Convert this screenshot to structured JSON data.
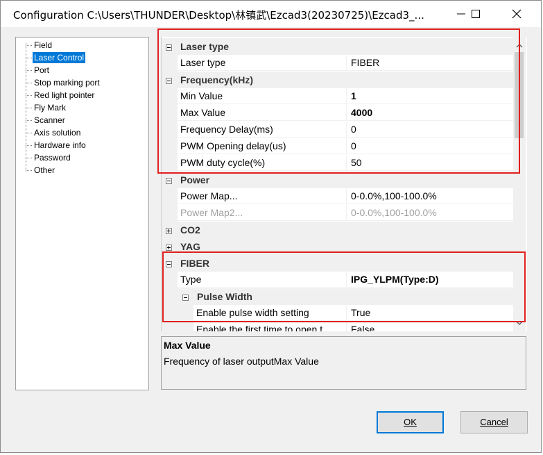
{
  "window": {
    "title": "Configuration C:\\Users\\THUNDER\\Desktop\\林镇武\\Ezcad3(20230725)\\Ezcad3_...",
    "buttons": [
      "minimize",
      "maximize",
      "close"
    ]
  },
  "tree": {
    "items": [
      {
        "label": "Field",
        "selected": false
      },
      {
        "label": "Laser Control",
        "selected": true
      },
      {
        "label": "Port",
        "selected": false
      },
      {
        "label": "Stop marking port",
        "selected": false
      },
      {
        "label": "Red light pointer",
        "selected": false
      },
      {
        "label": "Fly Mark",
        "selected": false
      },
      {
        "label": "Scanner",
        "selected": false
      },
      {
        "label": "Axis solution",
        "selected": false
      },
      {
        "label": "Hardware info",
        "selected": false
      },
      {
        "label": "Password",
        "selected": false
      },
      {
        "label": "Other",
        "selected": false
      }
    ]
  },
  "grid": {
    "rows": [
      {
        "kind": "category",
        "label": "Laser type",
        "expanded": true
      },
      {
        "kind": "prop",
        "name": "Laser type",
        "value": "FIBER"
      },
      {
        "kind": "category",
        "label": "Frequency(kHz)",
        "expanded": true
      },
      {
        "kind": "prop",
        "name": "Min Value",
        "value": "1",
        "bold": true
      },
      {
        "kind": "prop",
        "name": "Max Value",
        "value": "4000",
        "bold": true
      },
      {
        "kind": "prop",
        "name": "Frequency Delay(ms)",
        "value": "0"
      },
      {
        "kind": "prop",
        "name": "PWM Opening delay(us)",
        "value": "0"
      },
      {
        "kind": "prop",
        "name": "PWM duty cycle(%)",
        "value": "50"
      },
      {
        "kind": "category",
        "label": "Power",
        "expanded": true
      },
      {
        "kind": "prop",
        "name": "Power Map...",
        "value": "0-0.0%,100-100.0%"
      },
      {
        "kind": "prop",
        "name": "Power Map2...",
        "value": "0-0.0%,100-100.0%",
        "disabled": true
      },
      {
        "kind": "category",
        "label": "CO2",
        "expanded": false
      },
      {
        "kind": "category",
        "label": "YAG",
        "expanded": false
      },
      {
        "kind": "category",
        "label": "FIBER",
        "expanded": true
      },
      {
        "kind": "prop",
        "name": "Type",
        "value": "IPG_YLPM(Type:D)",
        "bold": true
      },
      {
        "kind": "subcategory",
        "label": "Pulse Width",
        "expanded": true
      },
      {
        "kind": "subprop",
        "name": "Enable pulse width setting",
        "value": "True"
      },
      {
        "kind": "subprop",
        "name": "Enable the first time to open t",
        "value": "False"
      }
    ]
  },
  "description": {
    "title": "Max Value",
    "text": "Frequency of laser outputMax Value"
  },
  "buttons": {
    "ok": "OK",
    "cancel": "Cancel"
  },
  "colors": {
    "selection": "#0078d7",
    "annotation": "#e0201e"
  }
}
